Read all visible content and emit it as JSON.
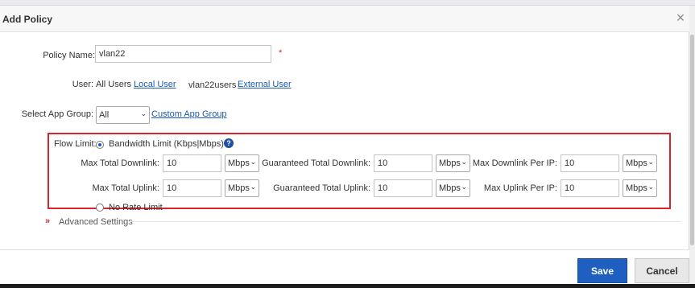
{
  "dialog": {
    "title": "Add Policy",
    "close_icon": "×"
  },
  "policy_name": {
    "label": "Policy Name:",
    "value": "vlan22",
    "required_mark": "*"
  },
  "user": {
    "label": "User:",
    "all_users": "All Users",
    "local_user_link": "Local User",
    "user_value": "vlan22users",
    "external_user_link": "External User"
  },
  "app_group": {
    "label": "Select App Group:",
    "selected": "All",
    "custom_link": "Custom App Group"
  },
  "flow_limit": {
    "label": "Flow Limit:",
    "bandwidth_option": "Bandwidth Limit (Kbps|Mbps)",
    "help_icon": "?",
    "no_limit_option": "No Rate Limit",
    "rows": [
      {
        "left_label": "Max Total Downlink:",
        "left_value": "10",
        "left_unit": "Mbps",
        "mid_label": "Guaranteed Total Downlink:",
        "mid_value": "10",
        "mid_unit": "Mbps",
        "right_label": "Max Downlink Per IP:",
        "right_value": "10",
        "right_unit": "Mbps"
      },
      {
        "left_label": "Max Total Uplink:",
        "left_value": "10",
        "left_unit": "Mbps",
        "mid_label": "Guaranteed Total Uplink:",
        "mid_value": "10",
        "mid_unit": "Mbps",
        "right_label": "Max Uplink Per IP:",
        "right_value": "10",
        "right_unit": "Mbps"
      }
    ]
  },
  "advanced": {
    "arrow": "»",
    "label": "Advanced Settings"
  },
  "footer": {
    "save_label": "Save",
    "cancel_label": "Cancel"
  },
  "colors": {
    "accent": "#1f5fbf",
    "highlight_border": "#d9232d",
    "link": "#1a5bb5"
  }
}
